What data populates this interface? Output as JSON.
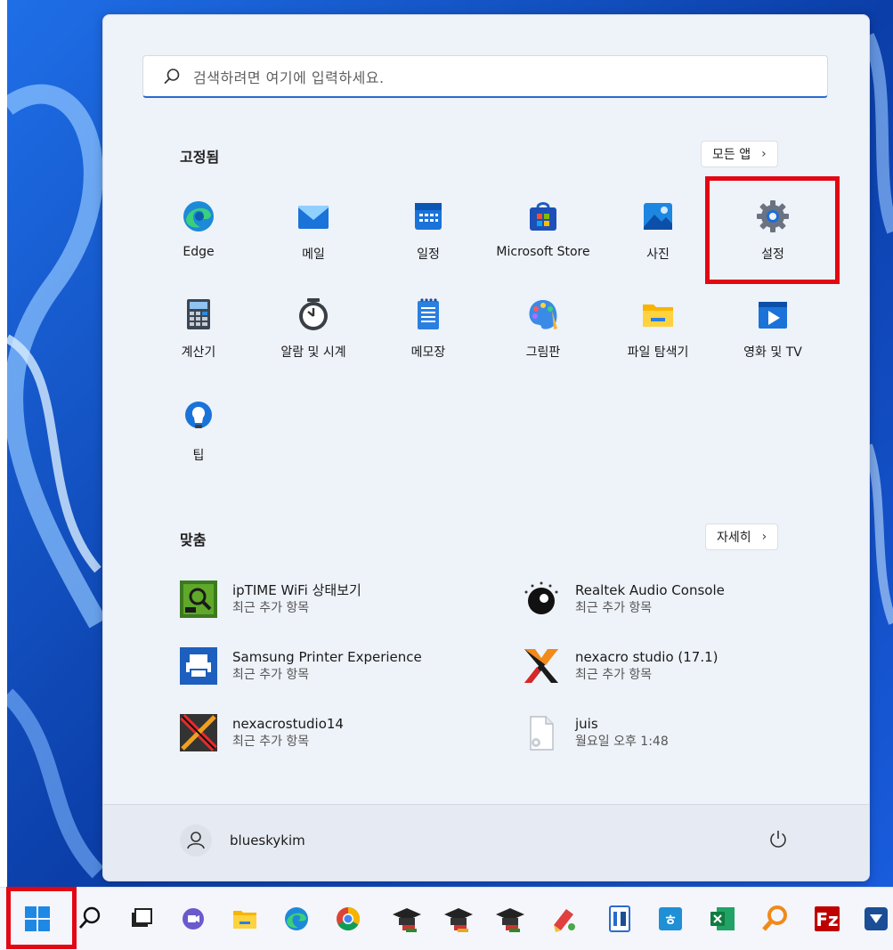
{
  "search": {
    "placeholder": "검색하려면 여기에 입력하세요."
  },
  "pinned": {
    "title": "고정됨",
    "all_apps_label": "모든 앱",
    "apps": [
      {
        "label": "Edge",
        "icon": "edge-icon"
      },
      {
        "label": "메일",
        "icon": "mail-icon"
      },
      {
        "label": "일정",
        "icon": "calendar-icon"
      },
      {
        "label": "Microsoft Store",
        "icon": "store-icon"
      },
      {
        "label": "사진",
        "icon": "photos-icon"
      },
      {
        "label": "설정",
        "icon": "gear-icon"
      },
      {
        "label": "계산기",
        "icon": "calculator-icon"
      },
      {
        "label": "알람 및 시계",
        "icon": "clock-icon"
      },
      {
        "label": "메모장",
        "icon": "notepad-icon"
      },
      {
        "label": "그림판",
        "icon": "paint-icon"
      },
      {
        "label": "파일 탐색기",
        "icon": "folder-icon"
      },
      {
        "label": "영화 및 TV",
        "icon": "movies-icon"
      },
      {
        "label": "팁",
        "icon": "tips-icon"
      }
    ]
  },
  "recommended": {
    "title": "맞춤",
    "more_label": "자세히",
    "items": [
      {
        "name": "ipTIME WiFi 상태보기",
        "sub": "최근 추가 항목"
      },
      {
        "name": "Realtek Audio Console",
        "sub": "최근 추가 항목"
      },
      {
        "name": "Samsung Printer Experience",
        "sub": "최근 추가 항목"
      },
      {
        "name": "nexacro studio (17.1)",
        "sub": "최근 추가 항목"
      },
      {
        "name": "nexacrostudio14",
        "sub": "최근 추가 항목"
      },
      {
        "name": "juis",
        "sub": "월요일 오후 1:48"
      }
    ]
  },
  "user": {
    "name": "blueskykim"
  },
  "colors": {
    "highlight": "#e30613",
    "accent": "#2a6ad0"
  },
  "taskbar_icons": [
    "start-icon",
    "search-icon",
    "task-view-icon",
    "chat-icon",
    "file-explorer-icon",
    "edge-icon",
    "chrome-icon",
    "graduation-app-icon",
    "graduation-app-icon",
    "graduation-app-icon",
    "paint-tool-icon",
    "doc-app-icon",
    "hancom-icon",
    "excel-icon",
    "search-magnifier-app-icon",
    "filezilla-icon",
    "app-icon"
  ]
}
